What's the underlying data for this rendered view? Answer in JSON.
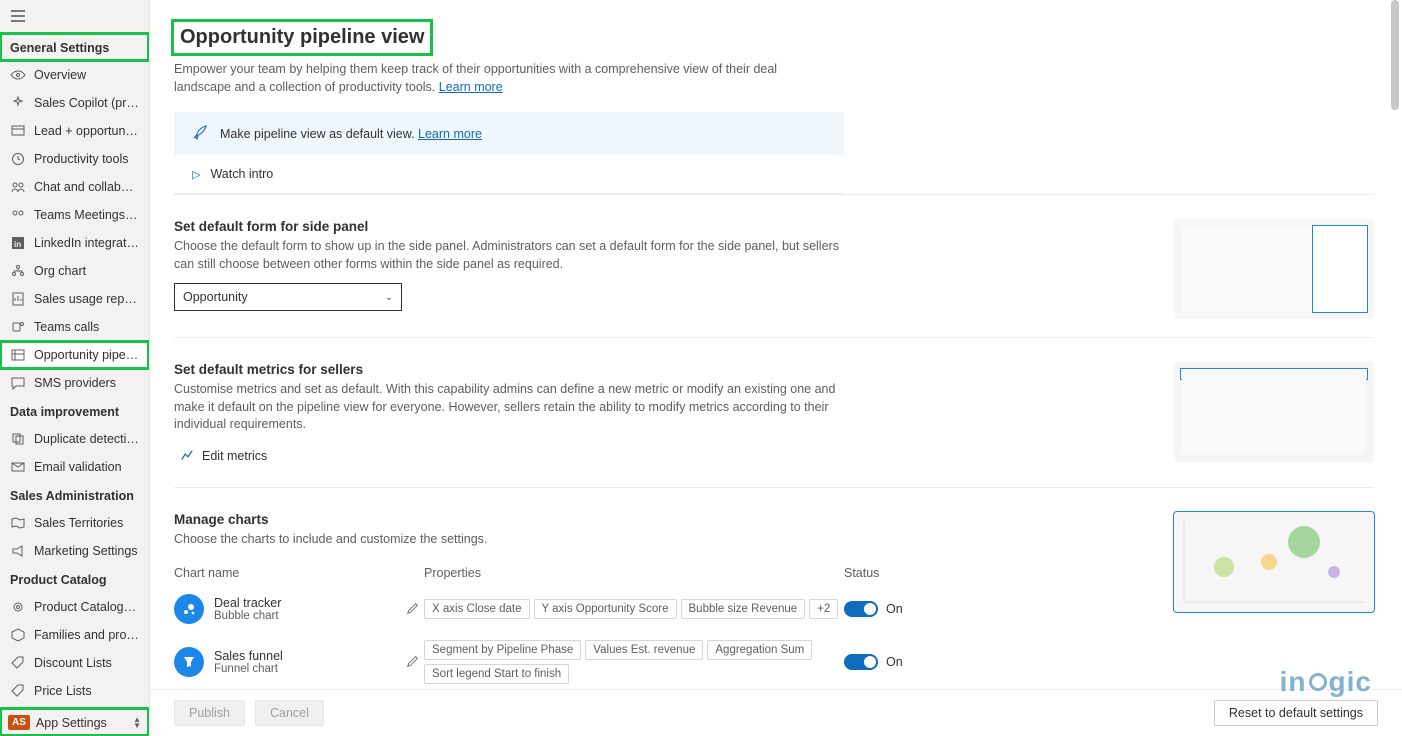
{
  "sidebar": {
    "group_general": "General Settings",
    "items_general": [
      {
        "label": "Overview"
      },
      {
        "label": "Sales Copilot (pre..."
      },
      {
        "label": "Lead + opportunit..."
      },
      {
        "label": "Productivity tools"
      },
      {
        "label": "Chat and collabor..."
      },
      {
        "label": "Teams Meetings (..."
      },
      {
        "label": "LinkedIn integration"
      },
      {
        "label": "Org chart"
      },
      {
        "label": "Sales usage reports"
      },
      {
        "label": "Teams calls"
      },
      {
        "label": "Opportunity pipeli..."
      },
      {
        "label": "SMS providers"
      }
    ],
    "group_data": "Data improvement",
    "items_data": [
      {
        "label": "Duplicate detection"
      },
      {
        "label": "Email validation"
      }
    ],
    "group_sales": "Sales Administration",
    "items_sales": [
      {
        "label": "Sales Territories"
      },
      {
        "label": "Marketing Settings"
      }
    ],
    "group_catalog": "Product Catalog",
    "items_catalog": [
      {
        "label": "Product Catalog S..."
      },
      {
        "label": "Families and prod..."
      },
      {
        "label": "Discount Lists"
      },
      {
        "label": "Price Lists"
      }
    ],
    "footer_badge": "AS",
    "footer_label": "App Settings"
  },
  "page": {
    "title": "Opportunity pipeline view",
    "desc_prefix": "Empower your team by helping them keep track of their opportunities with a comprehensive view of their deal landscape and a collection of productivity tools. ",
    "learn_more": "Learn more",
    "banner_text": "Make pipeline view as default view. ",
    "banner_link": "Learn more",
    "watch_intro": "Watch intro"
  },
  "section_form": {
    "title": "Set default form for side panel",
    "desc": "Choose the default form to show up in the side panel. Administrators can set a default form for the side panel, but sellers can still choose between other forms within the side panel as required.",
    "selected": "Opportunity"
  },
  "section_metrics": {
    "title": "Set default metrics for sellers",
    "desc": "Customise metrics and set as default. With this capability admins can define a new metric or modify an existing one and make it default on the pipeline view for everyone. However, sellers retain the ability to modify metrics according to their individual requirements.",
    "edit_label": "Edit metrics"
  },
  "section_charts": {
    "title": "Manage charts",
    "desc": "Choose the charts to include and customize the settings.",
    "col_name": "Chart name",
    "col_props": "Properties",
    "col_status": "Status",
    "rows": [
      {
        "name": "Deal tracker",
        "sub": "Bubble chart",
        "chips": [
          "X axis Close date",
          "Y axis Opportunity Score",
          "Bubble size Revenue",
          "+2"
        ],
        "status": "On"
      },
      {
        "name": "Sales funnel",
        "sub": "Funnel chart",
        "chips": [
          "Segment by Pipeline Phase",
          "Values Est. revenue",
          "Aggregation Sum",
          "Sort legend Start to finish"
        ],
        "status": "On"
      }
    ]
  },
  "footer": {
    "publish": "Publish",
    "cancel": "Cancel",
    "reset": "Reset to default settings"
  },
  "watermark": "in gic"
}
